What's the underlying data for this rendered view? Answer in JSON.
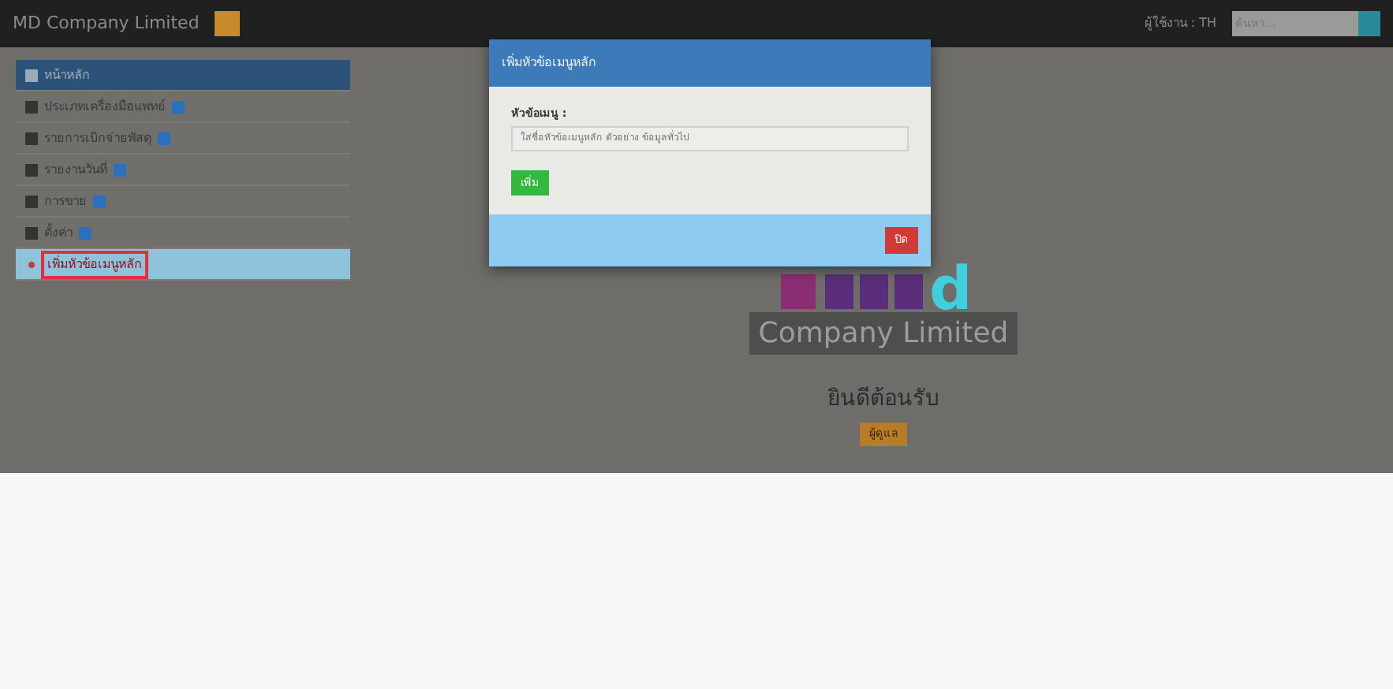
{
  "navbar": {
    "brand": "MD Company Limited",
    "user": "ผู้ใช้งาน : TH",
    "search": {
      "placeholder": "ค้นหา..."
    }
  },
  "sidebar": {
    "items": [
      {
        "label": "หน้าหลัก",
        "kind": "home",
        "selected": true,
        "outlined": false
      },
      {
        "label": "ประเภทเครื่องมือแพทย์",
        "kind": "menu",
        "selected": false,
        "outlined": false
      },
      {
        "label": "รายการเบิกจ่ายพัสดุ",
        "kind": "menu",
        "selected": false,
        "outlined": false
      },
      {
        "label": "รายงานวันที่",
        "kind": "menu",
        "selected": false,
        "outlined": false
      },
      {
        "label": "การขาย",
        "kind": "menu",
        "selected": false,
        "outlined": false
      },
      {
        "label": "ตั้งค่า",
        "kind": "menu",
        "selected": false,
        "outlined": false
      },
      {
        "label": "เพิ่มหัวข้อเมนูหลัก",
        "kind": "add",
        "selected": false,
        "outlined": true
      }
    ]
  },
  "welcome": {
    "logo_letter": "d",
    "company": "Company Limited",
    "greeting": "ยินดีต้อนรับ",
    "badge": "ผู้ดูแล"
  },
  "modal": {
    "title": "เพิ่มหัวข้อเมนูหลัก",
    "field_label": "หัวข้อเมนู :",
    "placeholder": "ใส่ชื่อหัวข้อเมนูหลัก ตัวอย่าง ข้อมูลทั่วไป",
    "submit": "เพิ่ม",
    "close": "ปิด"
  }
}
